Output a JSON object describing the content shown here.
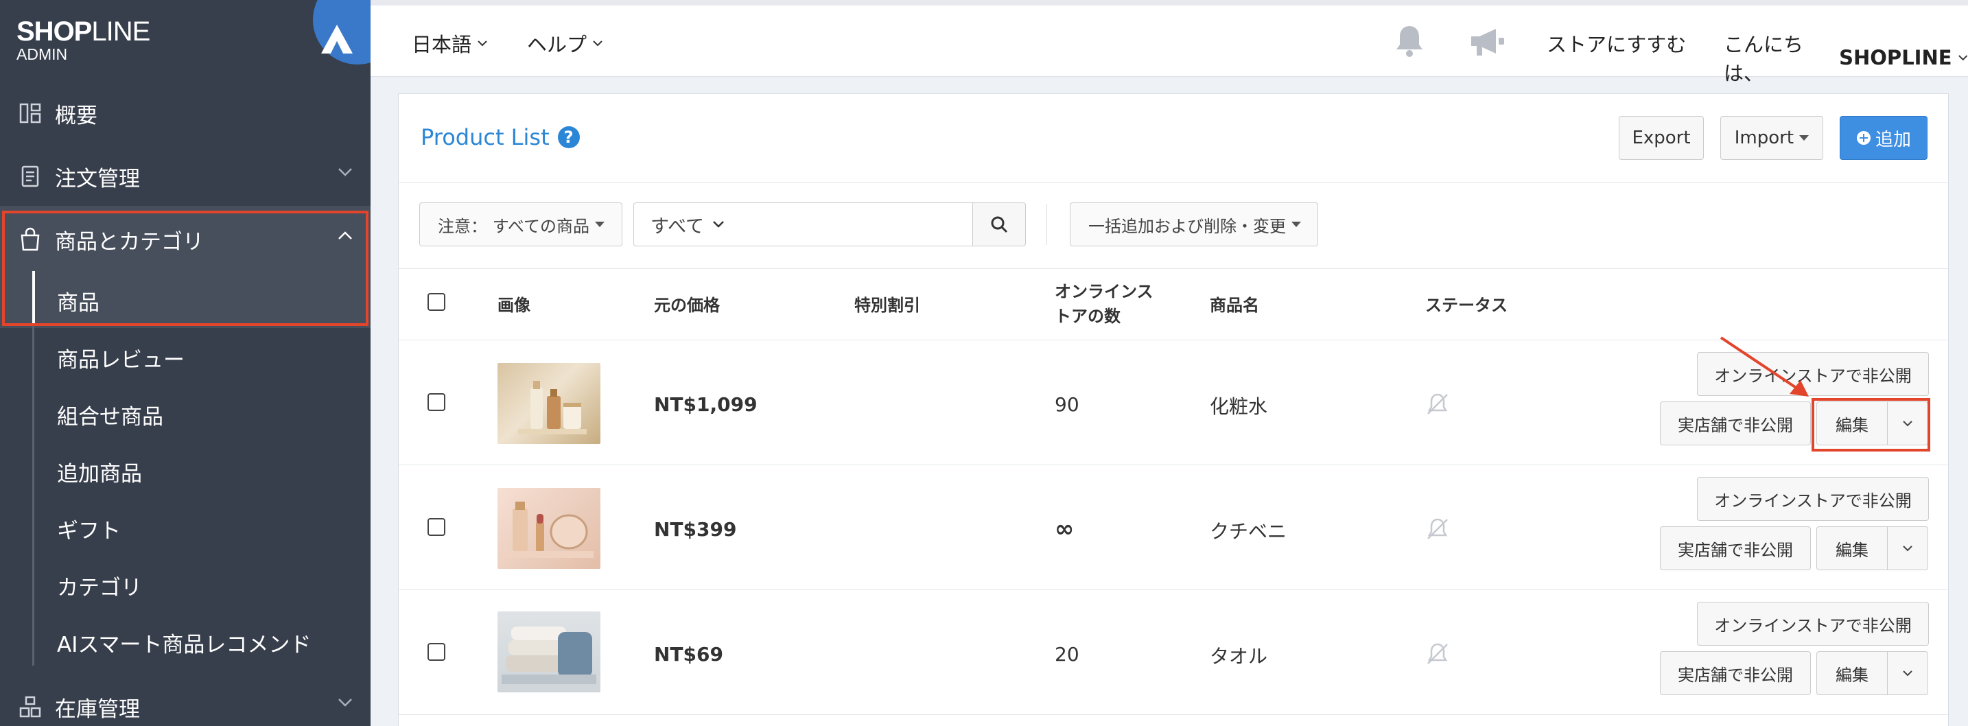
{
  "sidebar": {
    "brand_a": "SHOP",
    "brand_b": "LINE",
    "brand_sub": "ADMIN",
    "items": [
      {
        "label": "概要",
        "icon": "dashboard-icon"
      },
      {
        "label": "注文管理",
        "icon": "order-icon"
      },
      {
        "label": "商品とカテゴリ",
        "icon": "shopping-bag-icon"
      },
      {
        "label": "在庫管理",
        "icon": "inventory-icon"
      }
    ],
    "sub_items": [
      "商品",
      "商品レビュー",
      "組合せ商品",
      "追加商品",
      "ギフト",
      "カテゴリ",
      "AIスマート商品レコメンド"
    ]
  },
  "topbar": {
    "language": "日本語",
    "help": "ヘルプ",
    "visit_store": "ストアにすすむ",
    "greeting": "こんにちは、",
    "user": "SHOPLINE"
  },
  "panel": {
    "title": "Product List",
    "help_glyph": "?",
    "export": "Export",
    "import": "Import",
    "add": "追加",
    "filter_products": "注意： すべての商品",
    "filter_scope": "すべて",
    "search_placeholder": "",
    "bulk": "一括追加および削除・変更"
  },
  "table": {
    "headers": {
      "image": "画像",
      "price": "元の価格",
      "sale": "特別割引",
      "online_qty_1": "オンラインス",
      "online_qty_2": "トアの数",
      "name": "商品名",
      "status": "ステータス"
    },
    "rows": [
      {
        "price": "NT$1,099",
        "qty": "90",
        "name": "化粧水"
      },
      {
        "price": "NT$399",
        "qty": "∞",
        "name": "クチベニ"
      },
      {
        "price": "NT$69",
        "qty": "20",
        "name": "タオル"
      }
    ],
    "actions": {
      "hide_online": "オンラインストアで非公開",
      "hide_store": "実店舗で非公開",
      "edit": "編集"
    }
  },
  "colors": {
    "sidebar_bg": "#383f4c",
    "accent_blue": "#2c86d6",
    "primary_btn": "#3e8ee2",
    "highlight_red": "#e2452b"
  }
}
